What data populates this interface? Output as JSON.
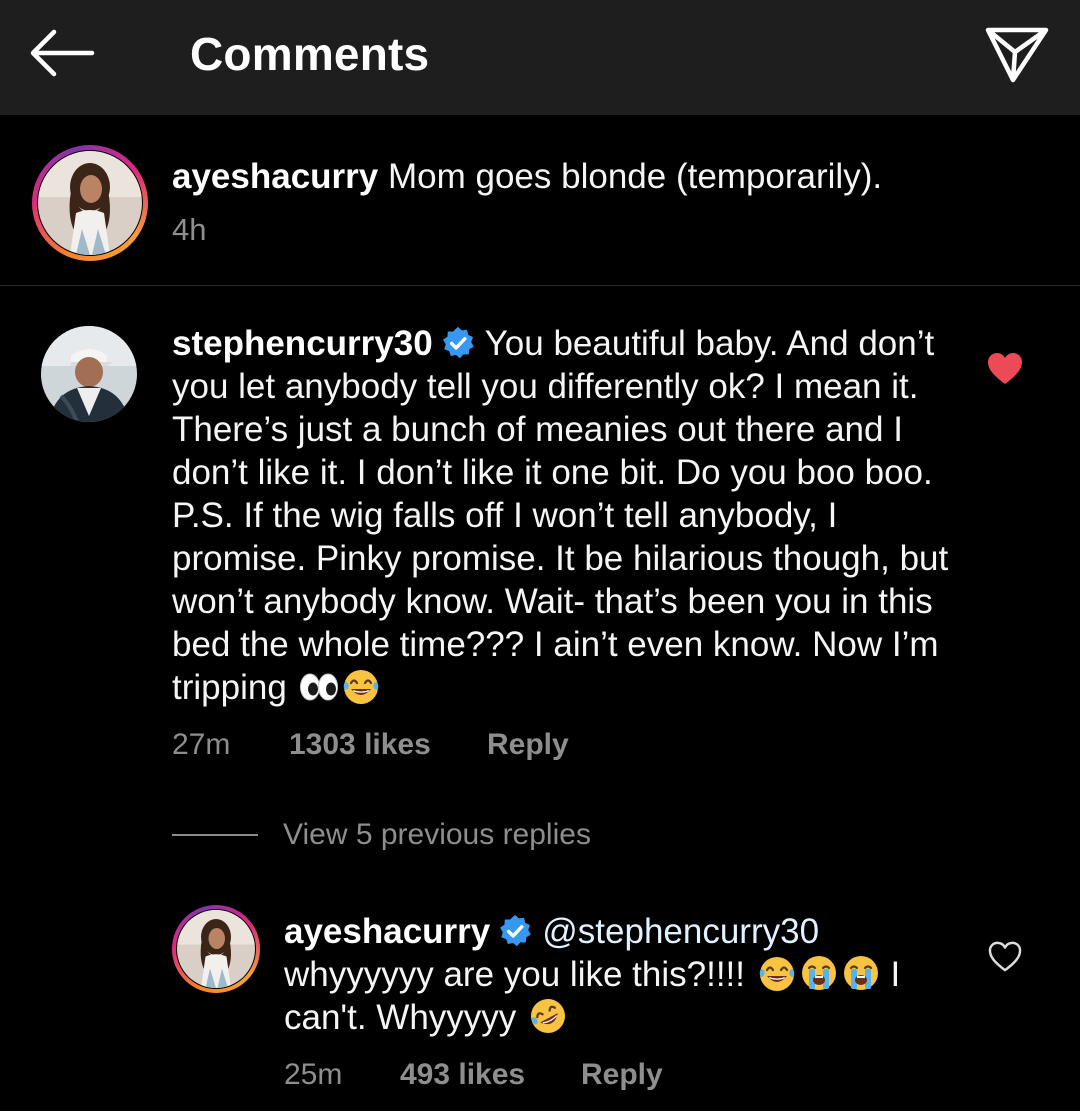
{
  "header": {
    "title": "Comments"
  },
  "caption": {
    "username": "ayeshacurry",
    "text": "Mom goes blonde (temporarily).",
    "time": "4h"
  },
  "main_comment": {
    "username": "stephencurry30",
    "verified": true,
    "text": "You beautiful baby. And don’t you let anybody tell you differently ok? I mean it. There’s just a bunch of meanies out there and I don’t like it. I don’t like it one bit. Do you boo boo. P.S. If the wig falls off I won’t tell anybody, I promise. Pinky promise. It be hilarious though, but won’t anybody know. Wait- that’s been you in this bed the whole time??? I ain’t even know. Now I’m tripping",
    "emojis": [
      "eyes-emoji",
      "tears-of-joy-emoji"
    ],
    "time": "27m",
    "likes": "1303 likes",
    "reply_label": "Reply",
    "liked": true
  },
  "view_replies": {
    "label": "View 5 previous replies"
  },
  "reply": {
    "username": "ayeshacurry",
    "verified": true,
    "mention": "@stephencurry30",
    "text_before_emoji": "whyyyyyy are you like this?!!!!",
    "text_after_emoji": "I can't. Whyyyyy",
    "emojis": [
      "tears-of-joy-emoji",
      "loudly-crying-emoji",
      "loudly-crying-emoji",
      "rolling-on-floor-laughing-emoji"
    ],
    "time": "25m",
    "likes": "493 likes",
    "reply_label": "Reply",
    "liked": false
  },
  "colors": {
    "header_bg": "#1e1e1e",
    "background": "#000000",
    "secondary_text": "#8e8e8e",
    "verified_blue": "#3897f0",
    "like_red": "#ed4956"
  }
}
